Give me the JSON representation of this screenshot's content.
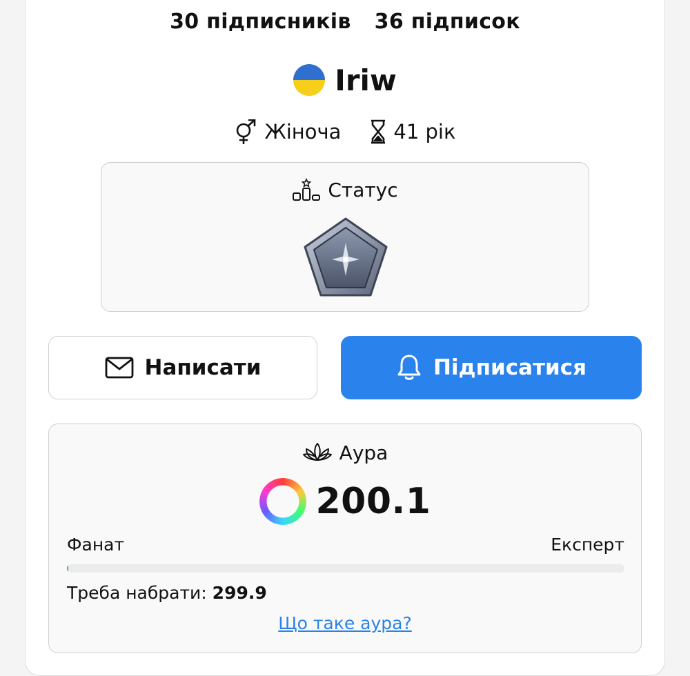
{
  "profile": {
    "followers_text": "30 підписників",
    "following_text": "36 підписок",
    "username": "Iriw",
    "gender": "Жіноча",
    "age": "41 рік",
    "flag_colors": [
      "#2f6fd0",
      "#f6cf1a"
    ]
  },
  "status": {
    "title": "Статус",
    "title_icon": "podium-star-icon",
    "badge_icon": "silver-pentagon-star-badge"
  },
  "actions": {
    "write_label": "Написати",
    "write_icon": "envelope-icon",
    "subscribe_label": "Підписатися",
    "subscribe_icon": "bell-icon",
    "subscribe_color": "#2a82ec"
  },
  "aura": {
    "title": "Аура",
    "title_icon": "lotus-icon",
    "value": "200.1",
    "level_from": "Фанат",
    "level_to": "Експерт",
    "progress_fraction": 0.001,
    "need_label": "Треба набрати:",
    "need_value": "299.9",
    "link_text": "Що таке аура?"
  }
}
